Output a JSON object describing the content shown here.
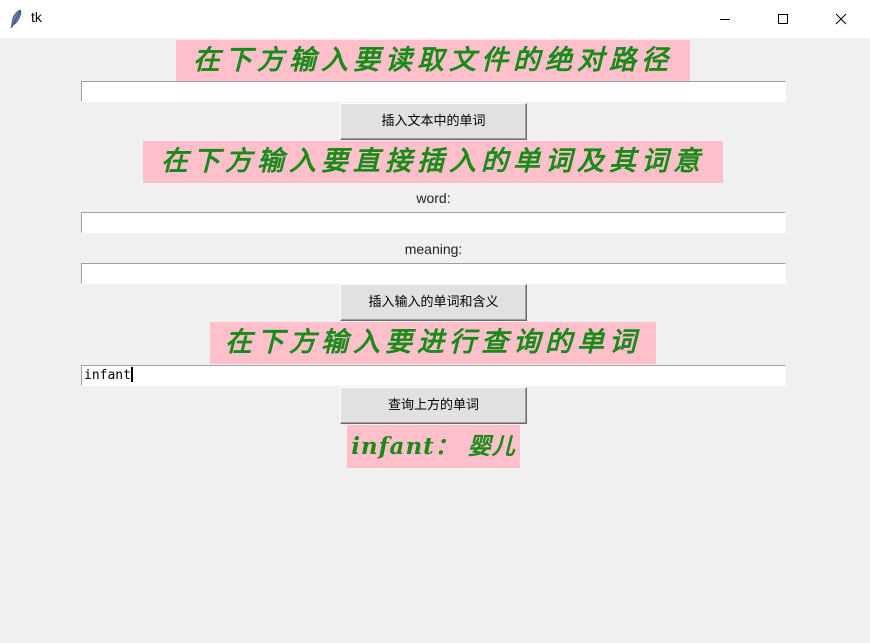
{
  "window": {
    "title": "tk",
    "icons": {
      "app": "feather-icon",
      "minimize": "minimize-icon",
      "maximize": "maximize-icon",
      "close": "close-icon"
    }
  },
  "colors": {
    "banner_bg": "#ffc0cb",
    "banner_text": "#1a8a1a",
    "window_bg": "#f0f0f0"
  },
  "file_section": {
    "heading": "在下方输入要读取文件的绝对路径",
    "path_value": "",
    "button_label": "插入文本中的单词"
  },
  "insert_section": {
    "heading": "在下方输入要直接插入的单词及其词意",
    "word_label": "word:",
    "word_value": "",
    "meaning_label": "meaning:",
    "meaning_value": "",
    "button_label": "插入输入的单词和含义"
  },
  "query_section": {
    "heading": "在下方输入要进行查询的单词",
    "query_value": "infant",
    "button_label": "查询上方的单词",
    "result": "infant： 婴儿"
  }
}
